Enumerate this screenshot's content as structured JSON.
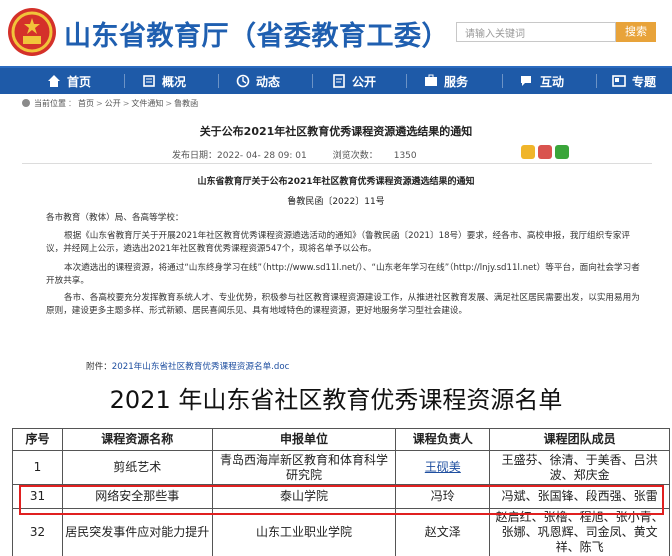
{
  "header": {
    "site_title": "山东省教育厅（省委教育工委）",
    "search_placeholder": "请输入关键词",
    "search_button": "搜索"
  },
  "nav": [
    {
      "label": "首页",
      "icon": "home-icon"
    },
    {
      "label": "概况",
      "icon": "overview-icon"
    },
    {
      "label": "动态",
      "icon": "news-icon"
    },
    {
      "label": "公开",
      "icon": "publicity-icon"
    },
    {
      "label": "服务",
      "icon": "service-icon"
    },
    {
      "label": "互动",
      "icon": "interaction-icon"
    },
    {
      "label": "专题",
      "icon": "topic-icon"
    }
  ],
  "breadcrumb": [
    "当前位置",
    "首页",
    "公开",
    "文件通知",
    "鲁教函"
  ],
  "article": {
    "title": "关于公布2021年社区教育优秀课程资源遴选结果的通知",
    "publish_label": "发布日期：",
    "publish_date": "2022- 04- 28 09: 01",
    "views_label": "浏览次数：",
    "views": "1350",
    "doc_heading": "山东省教育厅关于公布2021年社区教育优秀课程资源遴选结果的通知",
    "doc_number": "鲁教民函〔2022〕11号",
    "greeting": "各市教育（教体）局、各高等学校：",
    "para1": "根据《山东省教育厅关于开展2021年社区教育优秀课程资源遴选活动的通知》（鲁教民函〔2021〕18号）要求，经各市、高校申报，我厅组织专家评议，并经网上公示，遴选出2021年社区教育优秀课程资源547个，现将名单予以公布。",
    "para2": "本次遴选出的课程资源，将通过“山东终身学习在线”（http://www.sd11l.net/）、“山东老年学习在线”（http://lnjy.sd11l.net）等平台，面向社会学习者开放共享。",
    "para3": "各市、各高校要充分发挥教育系统人才、专业优势，积极参与社区教育课程资源建设工作，从推进社区教育发展、满足社区居民需要出发，以实用易用为原则，建设更多主题多样、形式新颖、居民喜闻乐见、具有地域特色的课程资源，更好地服务学习型社会建设。",
    "attachment_label": "附件：",
    "attachment_link": "2021年山东省社区教育优秀课程资源名单.doc"
  },
  "list_title": "2021 年山东省社区教育优秀课程资源名单",
  "table": {
    "headers": [
      "序号",
      "课程资源名称",
      "申报单位",
      "课程负责人",
      "课程团队成员"
    ],
    "rows": [
      {
        "no": "1",
        "name": "剪纸艺术",
        "unit": "青岛西海岸新区教育和体育科学研究院",
        "lead": "王砚美",
        "team": "王盛芬、徐清、于美香、吕洪波、郑庆金"
      },
      {
        "no": "31",
        "name": "网络安全那些事",
        "unit": "泰山学院",
        "lead": "冯玲",
        "team": "冯斌、张国锋、段西强、张雷"
      },
      {
        "no": "32",
        "name": "居民突发事件应对能力提升",
        "unit": "山东工业职业学院",
        "lead": "赵文泽",
        "team": "赵启红、张橹、程旭、张小青、张娜、巩恩辉、司金凤、黄文祥、陈飞"
      }
    ]
  },
  "colors": {
    "brand_blue": "#1f5fb0",
    "nav_blue": "#1e5aa8",
    "search_orange": "#e8a33a",
    "highlight_red": "#e02020"
  }
}
